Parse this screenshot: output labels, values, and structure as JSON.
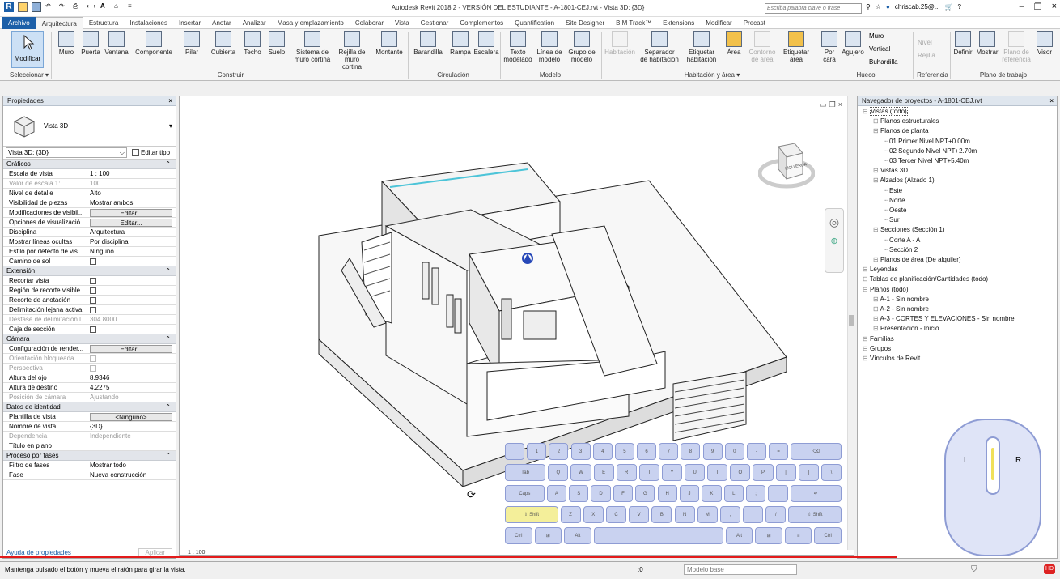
{
  "title_bar": {
    "title": "Autodesk Revit 2018.2 - VERSIÓN DEL ESTUDIANTE -   A-1801-CEJ.rvt - Vista 3D: {3D}",
    "search_placeholder": "Escriba palabra clave o frase",
    "user": "chriscab.25@..."
  },
  "tabs": [
    "Archivo",
    "Arquitectura",
    "Estructura",
    "Instalaciones",
    "Insertar",
    "Anotar",
    "Analizar",
    "Masa y emplazamiento",
    "Colaborar",
    "Vista",
    "Gestionar",
    "Complementos",
    "Quantification",
    "Site Designer",
    "BIM Track™",
    "Extensions",
    "Modificar",
    "Precast"
  ],
  "ribbon": {
    "modify": "Modificar",
    "select": "Seleccionar ▾",
    "build": [
      "Muro",
      "Puerta",
      "Ventana",
      "Componente",
      "Pilar",
      "Cubierta",
      "Techo",
      "Suelo",
      "Sistema de\nmuro cortina",
      "Rejilla de\nmuro cortina",
      "Montante"
    ],
    "build_group": "Construir",
    "circ": [
      "Barandilla",
      "Rampa",
      "Escalera"
    ],
    "circ_group": "Circulación",
    "model": [
      "Texto\nmodelado",
      "Línea de\nmodelo",
      "Grupo de\nmodelo"
    ],
    "model_group": "Modelo",
    "room": [
      "Habitación",
      "Separador\nde habitación",
      "Etiquetar\nhabitación",
      "Área",
      "Contorno\nde área",
      "Etiquetar\nárea"
    ],
    "room_group": "Habitación y área ▾",
    "opening": [
      "Por\ncara",
      "Agujero",
      "Muro",
      "Vertical",
      "Buhardilla"
    ],
    "opening_group": "Hueco",
    "datum": [
      "Nivel",
      "Rejilla"
    ],
    "datum_group": "Referencia",
    "work": [
      "Definir",
      "Mostrar",
      "Plano de\nreferencia",
      "Visor"
    ],
    "work_group": "Plano de trabajo"
  },
  "properties": {
    "header": "Propiedades",
    "type": "Vista 3D",
    "selector": "Vista 3D: {3D}",
    "edit_type": "Editar tipo",
    "sections": [
      {
        "name": "Gráficos",
        "rows": [
          [
            "Escala de vista",
            "1 : 100",
            ""
          ],
          [
            "Valor de escala    1:",
            "100",
            "g"
          ],
          [
            "Nivel de detalle",
            "Alto",
            ""
          ],
          [
            "Visibilidad de piezas",
            "Mostrar ambos",
            ""
          ],
          [
            "Modificaciones de visibil...",
            "Editar...",
            "b"
          ],
          [
            "Opciones de visualizació...",
            "Editar...",
            "b"
          ],
          [
            "Disciplina",
            "Arquitectura",
            ""
          ],
          [
            "Mostrar líneas ocultas",
            "Por disciplina",
            ""
          ],
          [
            "Estilo por defecto de vis...",
            "Ninguno",
            ""
          ],
          [
            "Camino de sol",
            "",
            "c"
          ]
        ]
      },
      {
        "name": "Extensión",
        "rows": [
          [
            "Recortar vista",
            "",
            "c"
          ],
          [
            "Región de recorte visible",
            "",
            "c"
          ],
          [
            "Recorte de anotación",
            "",
            "c"
          ],
          [
            "Delimitación lejana activa",
            "",
            "c"
          ],
          [
            "Desfase de delimitación l...",
            "304.8000",
            "g"
          ],
          [
            "Caja de sección",
            "",
            "c"
          ]
        ]
      },
      {
        "name": "Cámara",
        "rows": [
          [
            "Configuración de render...",
            "Editar...",
            "b"
          ],
          [
            "Orientación bloqueada",
            "",
            "gc"
          ],
          [
            "Perspectiva",
            "",
            "gc"
          ],
          [
            "Altura del ojo",
            "8.9346",
            ""
          ],
          [
            "Altura de destino",
            "4.2275",
            ""
          ],
          [
            "Posición de cámara",
            "Ajustando",
            "g"
          ]
        ]
      },
      {
        "name": "Datos de identidad",
        "rows": [
          [
            "Plantilla de vista",
            "<Ninguno>",
            "b"
          ],
          [
            "Nombre de vista",
            "{3D}",
            ""
          ],
          [
            "Dependencia",
            "Independiente",
            "g"
          ],
          [
            "Título en plano",
            "",
            ""
          ]
        ]
      },
      {
        "name": "Proceso por fases",
        "rows": [
          [
            "Filtro de fases",
            "Mostrar todo",
            ""
          ],
          [
            "Fase",
            "Nueva construcción",
            ""
          ]
        ]
      }
    ],
    "help": "Ayuda de propiedades",
    "apply": "Aplicar"
  },
  "browser": {
    "header": "Navegador de proyectos - A-1801-CEJ.rvt",
    "items": [
      [
        "Vistas (todo)",
        0
      ],
      [
        "Planos estructurales",
        1
      ],
      [
        "Planos de planta",
        1
      ],
      [
        "01 Primer Nivel NPT+0.00m",
        2
      ],
      [
        "02 Segundo Nivel NPT+2.70m",
        2
      ],
      [
        "03 Tercer Nivel NPT+5.40m",
        2
      ],
      [
        "Vistas 3D",
        1
      ],
      [
        "Alzados (Alzado 1)",
        1
      ],
      [
        "Este",
        2
      ],
      [
        "Norte",
        2
      ],
      [
        "Oeste",
        2
      ],
      [
        "Sur",
        2
      ],
      [
        "Secciones (Sección  1)",
        1
      ],
      [
        "Corte A - A",
        2
      ],
      [
        "Sección 2",
        2
      ],
      [
        "Planos de área (De alquiler)",
        1
      ],
      [
        "Leyendas",
        0
      ],
      [
        "Tablas de planificación/Cantidades (todo)",
        0
      ],
      [
        "Planos (todo)",
        0
      ],
      [
        "A-1 - Sin nombre",
        1
      ],
      [
        "A-2 - Sin nombre",
        1
      ],
      [
        "A-3 - CORTES Y ELEVACIONES - Sin nombre",
        1
      ],
      [
        "Presentación - Inicio",
        1
      ],
      [
        "Familias",
        0
      ],
      [
        "Grupos",
        0
      ],
      [
        "Vínculos de Revit",
        0
      ]
    ]
  },
  "viewcube": {
    "face": "IZQUIERDA"
  },
  "keyboard": {
    "row1": [
      "`",
      "1",
      "2",
      "3",
      "4",
      "5",
      "6",
      "7",
      "8",
      "9",
      "0",
      "-",
      "=",
      "⌫"
    ],
    "row2": [
      "Tab",
      "Q",
      "W",
      "E",
      "R",
      "T",
      "Y",
      "U",
      "I",
      "O",
      "P",
      "[",
      "]",
      "\\"
    ],
    "row3": [
      "Caps",
      "A",
      "S",
      "D",
      "F",
      "G",
      "H",
      "J",
      "K",
      "L",
      ";",
      "'",
      "↵"
    ],
    "row4": [
      "⇧ Shift",
      "Z",
      "X",
      "C",
      "V",
      "B",
      "N",
      "M",
      ",",
      ".",
      "/",
      "⇧ Shift"
    ],
    "row5": [
      "Ctrl",
      "⊞",
      "Alt",
      "",
      "Alt",
      "⊞",
      "≡",
      "Ctrl"
    ]
  },
  "mouse": {
    "left": "L",
    "right": "R"
  },
  "view_scale": "1 : 100",
  "status": {
    "message": "Mantenga pulsado el botón y mueva el ratón para girar la vista.",
    "coord": ":0",
    "model": "Modelo base"
  }
}
